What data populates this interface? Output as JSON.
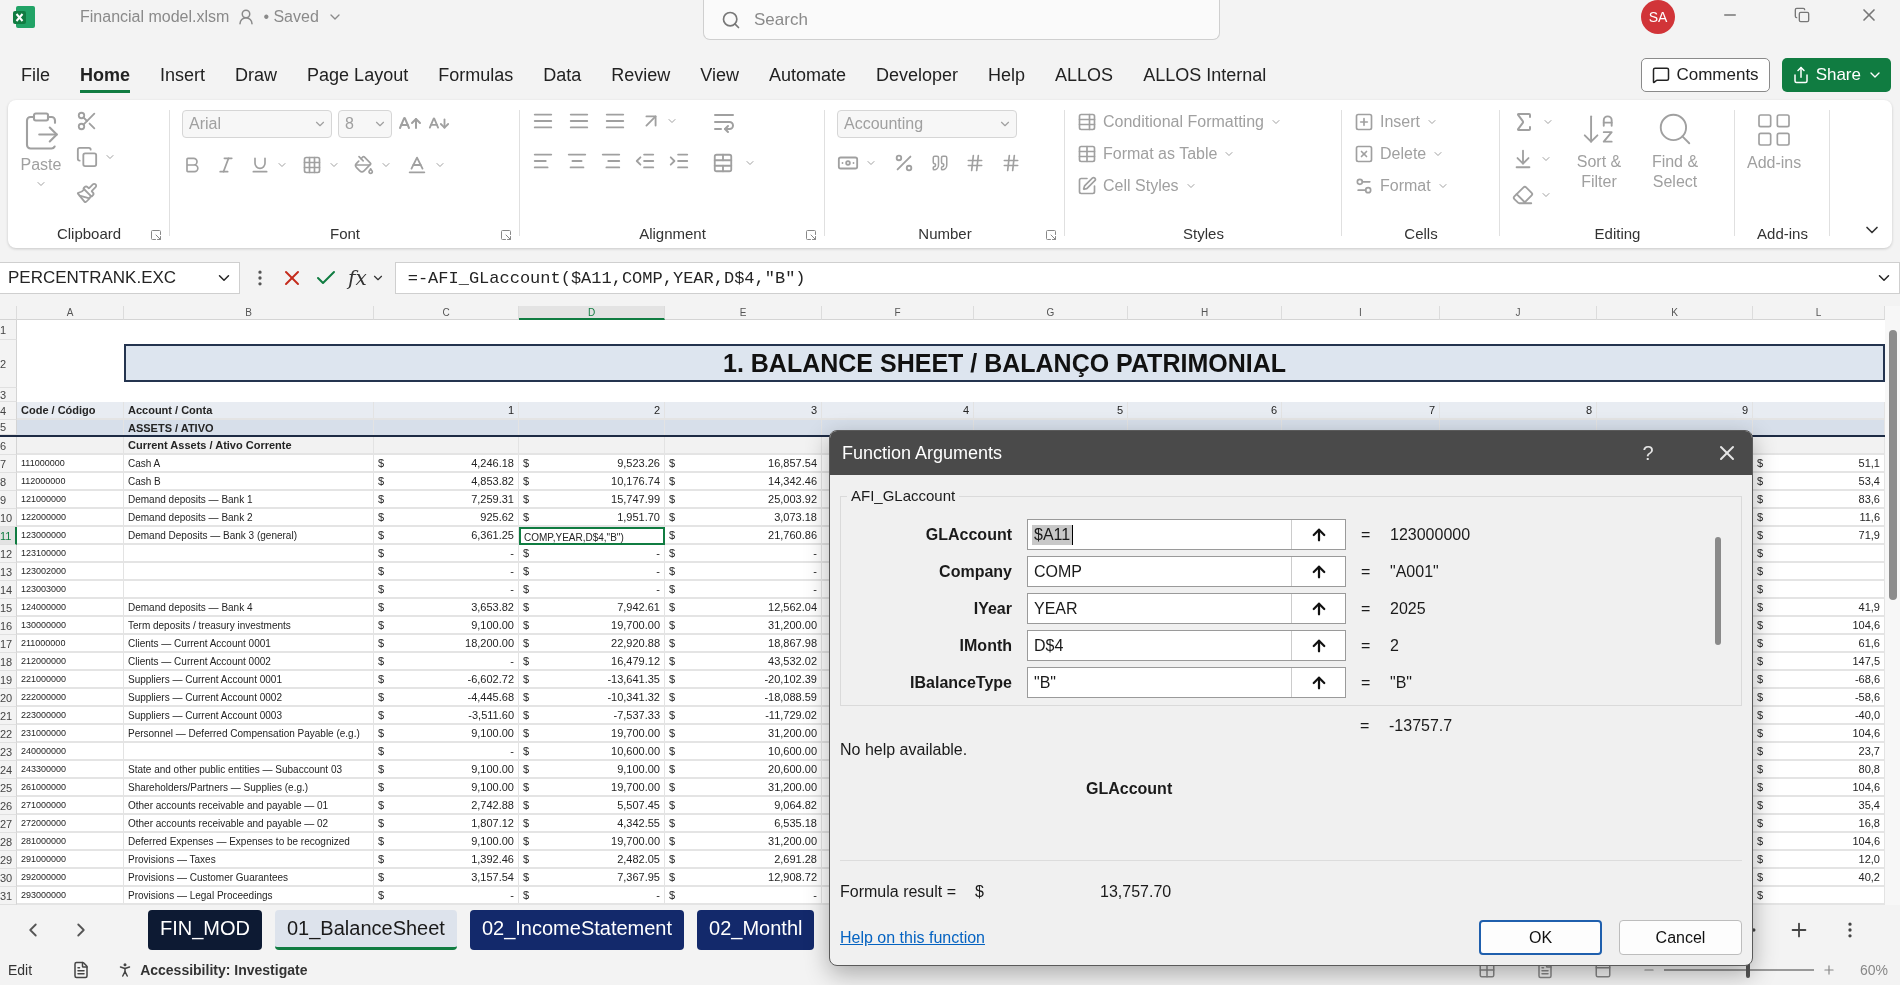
{
  "title_bar": {
    "file_name": "Financial model.xlsm",
    "save_status": "• Saved",
    "search_placeholder": "Search",
    "avatar": "SA"
  },
  "menu": {
    "tabs": [
      {
        "label": "File",
        "selected": false
      },
      {
        "label": "Home",
        "selected": true
      },
      {
        "label": "Insert",
        "selected": false
      },
      {
        "label": "Draw",
        "selected": false
      },
      {
        "label": "Page Layout",
        "selected": false
      },
      {
        "label": "Formulas",
        "selected": false
      },
      {
        "label": "Data",
        "selected": false
      },
      {
        "label": "Review",
        "selected": false
      },
      {
        "label": "View",
        "selected": false
      },
      {
        "label": "Automate",
        "selected": false
      },
      {
        "label": "Developer",
        "selected": false
      },
      {
        "label": "Help",
        "selected": false
      },
      {
        "label": "ALLOS",
        "selected": false
      },
      {
        "label": "ALLOS Internal",
        "selected": false
      }
    ],
    "comments": "Comments",
    "share": "Share"
  },
  "ribbon": {
    "disabled": true,
    "groups": [
      {
        "kind": "clipboard",
        "label": "Clipboard",
        "launcher": true,
        "items": [
          "Paste"
        ]
      },
      {
        "kind": "font",
        "label": "Font",
        "launcher": true,
        "items": [
          "Arial",
          "8"
        ]
      },
      {
        "kind": "alignment",
        "label": "Alignment",
        "launcher": true
      },
      {
        "kind": "number",
        "label": "Number",
        "launcher": true,
        "items": [
          "Accounting"
        ]
      },
      {
        "kind": "styles",
        "label": "Styles",
        "items": [
          "Conditional Formatting",
          "Format as Table",
          "Cell Styles"
        ]
      },
      {
        "kind": "cells",
        "label": "Cells",
        "items": [
          "Insert",
          "Delete",
          "Format"
        ]
      },
      {
        "kind": "editing",
        "label": "Editing",
        "items": [
          "Sort & Filter",
          "Find & Select"
        ]
      },
      {
        "kind": "addins",
        "label": "Add-ins",
        "items": [
          "Add-ins"
        ]
      }
    ]
  },
  "formula_bar": {
    "name_box": "PERCENTRANK.EXC",
    "fx": "fx",
    "formula": "=-AFI_GLaccount($A11,COMP,YEAR,D$4,\"B\")"
  },
  "sheet": {
    "column_letters": [
      {
        "label": "A",
        "selected": false
      },
      {
        "label": "B",
        "selected": false
      },
      {
        "label": "C",
        "selected": false
      },
      {
        "label": "D",
        "selected": true
      },
      {
        "label": "E",
        "selected": false
      },
      {
        "label": "F",
        "selected": false
      },
      {
        "label": "G",
        "selected": false
      },
      {
        "label": "H",
        "selected": false
      },
      {
        "label": "I",
        "selected": false
      },
      {
        "label": "J",
        "selected": false
      },
      {
        "label": "K",
        "selected": false
      },
      {
        "label": "L",
        "selected": false
      }
    ],
    "row_numbers": [
      {
        "label": "1",
        "selected": false
      },
      {
        "label": "2",
        "selected": false
      },
      {
        "label": "3",
        "selected": false
      },
      {
        "label": "4",
        "selected": false
      },
      {
        "label": "5",
        "selected": false
      },
      {
        "label": "6",
        "selected": false
      },
      {
        "label": "7",
        "selected": false
      },
      {
        "label": "8",
        "selected": false
      },
      {
        "label": "9",
        "selected": false
      },
      {
        "label": "10",
        "selected": false
      },
      {
        "label": "11",
        "selected": true
      },
      {
        "label": "12",
        "selected": false
      },
      {
        "label": "13",
        "selected": false
      },
      {
        "label": "14",
        "selected": false
      },
      {
        "label": "15",
        "selected": false
      },
      {
        "label": "16",
        "selected": false
      },
      {
        "label": "17",
        "selected": false
      },
      {
        "label": "18",
        "selected": false
      },
      {
        "label": "19",
        "selected": false
      },
      {
        "label": "20",
        "selected": false
      },
      {
        "label": "21",
        "selected": false
      },
      {
        "label": "22",
        "selected": false
      },
      {
        "label": "23",
        "selected": false
      },
      {
        "label": "24",
        "selected": false
      },
      {
        "label": "25",
        "selected": false
      },
      {
        "label": "26",
        "selected": false
      },
      {
        "label": "27",
        "selected": false
      },
      {
        "label": "28",
        "selected": false
      },
      {
        "label": "29",
        "selected": false
      },
      {
        "label": "30",
        "selected": false
      },
      {
        "label": "31",
        "selected": false
      }
    ],
    "title": "1. BALANCE SHEET / BALANÇO PATRIMONIAL",
    "header": {
      "code": "Code / Código",
      "account": "Account / Conta",
      "periods": [
        "1",
        "2",
        "3",
        "4",
        "5",
        "6",
        "7",
        "8",
        "9"
      ]
    },
    "section": "ASSETS / ATIVO",
    "subsection": "Current Assets / Ativo Corrente",
    "rows": [
      {
        "code": "111000000",
        "account": "Cash A",
        "cells": [
          {
            "sym": "$",
            "val": "4,246.18",
            "selected": false
          },
          {
            "sym": "$",
            "val": "9,523.26",
            "selected": false
          },
          {
            "sym": "$",
            "val": "16,857.54",
            "selected": false
          }
        ],
        "col_l": {
          "sym": "$",
          "val": "51,1"
        }
      },
      {
        "code": "112000000",
        "account": "Cash B",
        "cells": [
          {
            "sym": "$",
            "val": "4,853.82",
            "selected": false
          },
          {
            "sym": "$",
            "val": "10,176.74",
            "selected": false
          },
          {
            "sym": "$",
            "val": "14,342.46",
            "selected": false
          }
        ],
        "col_l": {
          "sym": "$",
          "val": "53,4"
        }
      },
      {
        "code": "121000000",
        "account": "Demand deposits — Bank 1",
        "cells": [
          {
            "sym": "$",
            "val": "7,259.31",
            "selected": false
          },
          {
            "sym": "$",
            "val": "15,747.99",
            "selected": false
          },
          {
            "sym": "$",
            "val": "25,003.92",
            "selected": false
          }
        ],
        "col_l": {
          "sym": "$",
          "val": "83,6"
        }
      },
      {
        "code": "122000000",
        "account": "Demand deposits — Bank 2",
        "cells": [
          {
            "sym": "$",
            "val": "925.62",
            "selected": false
          },
          {
            "sym": "$",
            "val": "1,951.70",
            "selected": false
          },
          {
            "sym": "$",
            "val": "3,073.18",
            "selected": false
          }
        ],
        "col_l": {
          "sym": "$",
          "val": "11,6"
        }
      },
      {
        "code": "123000000",
        "account": "Demand Deposits — Bank 3 (general)",
        "cells": [
          {
            "sym": "$",
            "val": "6,361.25",
            "selected": false
          },
          {
            "val": "COMP,YEAR,D$4,\"B\")",
            "selected": true
          },
          {
            "sym": "$",
            "val": "21,760.86",
            "selected": false
          }
        ],
        "col_l": {
          "sym": "$",
          "val": "71,9"
        }
      },
      {
        "code": "123100000",
        "cells": [
          {
            "sym": "$",
            "val": "-",
            "selected": false
          },
          {
            "sym": "$",
            "val": "-",
            "selected": false
          },
          {
            "sym": "$",
            "val": "-",
            "selected": false
          }
        ],
        "col_l": {
          "sym": "$"
        }
      },
      {
        "code": "123002000",
        "cells": [
          {
            "sym": "$",
            "val": "-",
            "selected": false
          },
          {
            "sym": "$",
            "val": "-",
            "selected": false
          },
          {
            "sym": "$",
            "val": "-",
            "selected": false
          }
        ],
        "col_l": {
          "sym": "$"
        }
      },
      {
        "code": "123003000",
        "cells": [
          {
            "sym": "$",
            "val": "-",
            "selected": false
          },
          {
            "sym": "$",
            "val": "-",
            "selected": false
          },
          {
            "sym": "$",
            "val": "-",
            "selected": false
          }
        ],
        "col_l": {
          "sym": "$"
        }
      },
      {
        "code": "124000000",
        "account": "Demand deposits — Bank 4",
        "cells": [
          {
            "sym": "$",
            "val": "3,653.82",
            "selected": false
          },
          {
            "sym": "$",
            "val": "7,942.61",
            "selected": false
          },
          {
            "sym": "$",
            "val": "12,562.04",
            "selected": false
          }
        ],
        "col_l": {
          "sym": "$",
          "val": "41,9"
        }
      },
      {
        "code": "130000000",
        "account": "Term deposits / treasury investments",
        "cells": [
          {
            "sym": "$",
            "val": "9,100.00",
            "selected": false
          },
          {
            "sym": "$",
            "val": "19,700.00",
            "selected": false
          },
          {
            "sym": "$",
            "val": "31,200.00",
            "selected": false
          }
        ],
        "col_l": {
          "sym": "$",
          "val": "104,6"
        }
      },
      {
        "code": "211000000",
        "account": "Clients — Current Account 0001",
        "cells": [
          {
            "sym": "$",
            "val": "18,200.00",
            "selected": false
          },
          {
            "sym": "$",
            "val": "22,920.88",
            "selected": false
          },
          {
            "sym": "$",
            "val": "18,867.98",
            "selected": false
          }
        ],
        "col_l": {
          "sym": "$",
          "val": "61,6"
        }
      },
      {
        "code": "212000000",
        "account": "Clients — Current Account 0002",
        "cells": [
          {
            "sym": "$",
            "val": "-",
            "selected": false
          },
          {
            "sym": "$",
            "val": "16,479.12",
            "selected": false
          },
          {
            "sym": "$",
            "val": "43,532.02",
            "selected": false
          }
        ],
        "col_l": {
          "sym": "$",
          "val": "147,5"
        }
      },
      {
        "code": "221000000",
        "account": "Suppliers — Current Account 0001",
        "cells": [
          {
            "sym": "$",
            "val": "-6,602.72",
            "selected": false
          },
          {
            "sym": "$",
            "val": "-13,641.35",
            "selected": false
          },
          {
            "sym": "$",
            "val": "-20,102.39",
            "selected": false
          }
        ],
        "col_l": {
          "sym": "$",
          "val": "-68,6"
        }
      },
      {
        "code": "222000000",
        "account": "Suppliers — Current Account 0002",
        "cells": [
          {
            "sym": "$",
            "val": "-4,445.68",
            "selected": false
          },
          {
            "sym": "$",
            "val": "-10,341.32",
            "selected": false
          },
          {
            "sym": "$",
            "val": "-18,088.59",
            "selected": false
          }
        ],
        "col_l": {
          "sym": "$",
          "val": "-58,6"
        }
      },
      {
        "code": "223000000",
        "account": "Suppliers — Current Account 0003",
        "cells": [
          {
            "sym": "$",
            "val": "-3,511.60",
            "selected": false
          },
          {
            "sym": "$",
            "val": "-7,537.33",
            "selected": false
          },
          {
            "sym": "$",
            "val": "-11,729.02",
            "selected": false
          }
        ],
        "col_l": {
          "sym": "$",
          "val": "-40,0"
        }
      },
      {
        "code": "231000000",
        "account": "Personnel — Deferred Compensation Payable (e.g.)",
        "cells": [
          {
            "sym": "$",
            "val": "9,100.00",
            "selected": false
          },
          {
            "sym": "$",
            "val": "19,700.00",
            "selected": false
          },
          {
            "sym": "$",
            "val": "31,200.00",
            "selected": false
          }
        ],
        "col_l": {
          "sym": "$",
          "val": "104,6"
        }
      },
      {
        "code": "240000000",
        "cells": [
          {
            "sym": "$",
            "val": "-",
            "selected": false
          },
          {
            "sym": "$",
            "val": "10,600.00",
            "selected": false
          },
          {
            "sym": "$",
            "val": "10,600.00",
            "selected": false
          }
        ],
        "col_l": {
          "sym": "$",
          "val": "23,7"
        }
      },
      {
        "code": "243300000",
        "account": "State and other public entities — Subaccount 03",
        "cells": [
          {
            "sym": "$",
            "val": "9,100.00",
            "selected": false
          },
          {
            "sym": "$",
            "val": "9,100.00",
            "selected": false
          },
          {
            "sym": "$",
            "val": "20,600.00",
            "selected": false
          }
        ],
        "col_l": {
          "sym": "$",
          "val": "80,8"
        }
      },
      {
        "code": "261000000",
        "account": "Shareholders/Partners — Supplies (e.g.)",
        "cells": [
          {
            "sym": "$",
            "val": "9,100.00",
            "selected": false
          },
          {
            "sym": "$",
            "val": "19,700.00",
            "selected": false
          },
          {
            "sym": "$",
            "val": "31,200.00",
            "selected": false
          }
        ],
        "col_l": {
          "sym": "$",
          "val": "104,6"
        }
      },
      {
        "code": "271000000",
        "account": "Other accounts receivable and payable — 01",
        "cells": [
          {
            "sym": "$",
            "val": "2,742.88",
            "selected": false
          },
          {
            "sym": "$",
            "val": "5,507.45",
            "selected": false
          },
          {
            "sym": "$",
            "val": "9,064.82",
            "selected": false
          }
        ],
        "col_l": {
          "sym": "$",
          "val": "35,4"
        }
      },
      {
        "code": "272000000",
        "account": "Other accounts receivable and payable — 02",
        "cells": [
          {
            "sym": "$",
            "val": "1,807.12",
            "selected": false
          },
          {
            "sym": "$",
            "val": "4,342.55",
            "selected": false
          },
          {
            "sym": "$",
            "val": "6,535.18",
            "selected": false
          }
        ],
        "col_l": {
          "sym": "$",
          "val": "16,8"
        }
      },
      {
        "code": "281000000",
        "account": "Deferred Expenses — Expenses to be recognized",
        "cells": [
          {
            "sym": "$",
            "val": "9,100.00",
            "selected": false
          },
          {
            "sym": "$",
            "val": "19,700.00",
            "selected": false
          },
          {
            "sym": "$",
            "val": "31,200.00",
            "selected": false
          }
        ],
        "col_l": {
          "sym": "$",
          "val": "104,6"
        }
      },
      {
        "code": "291000000",
        "account": "Provisions — Taxes",
        "cells": [
          {
            "sym": "$",
            "val": "1,392.46",
            "selected": false
          },
          {
            "sym": "$",
            "val": "2,482.05",
            "selected": false
          },
          {
            "sym": "$",
            "val": "2,691.28",
            "selected": false
          }
        ],
        "col_l": {
          "sym": "$",
          "val": "12,0"
        }
      },
      {
        "code": "292000000",
        "account": "Provisions — Customer Guarantees",
        "cells": [
          {
            "sym": "$",
            "val": "3,157.54",
            "selected": false
          },
          {
            "sym": "$",
            "val": "7,367.95",
            "selected": false
          },
          {
            "sym": "$",
            "val": "12,908.72",
            "selected": false
          }
        ],
        "col_l": {
          "sym": "$",
          "val": "40,2"
        }
      },
      {
        "code": "293000000",
        "account": "Provisions — Legal Proceedings",
        "cells": [
          {
            "sym": "$",
            "val": "-",
            "selected": false
          },
          {
            "sym": "$",
            "val": "-",
            "selected": false
          },
          {
            "sym": "$",
            "val": "-",
            "selected": false
          }
        ],
        "col_l": {
          "sym": "$"
        }
      }
    ]
  },
  "sheet_tabs": [
    {
      "label": "FIN_MOD",
      "selected": false,
      "color": "#0d1a33"
    },
    {
      "label": "01_BalanceSheet",
      "selected": true,
      "color": "#dde3ec"
    },
    {
      "label": "02_IncomeStatement",
      "selected": false,
      "color": "#13296b"
    },
    {
      "label": "02_Monthl",
      "selected": false,
      "color": "#13296b"
    }
  ],
  "status_bar": {
    "mode": "Edit",
    "accessibility": "Accessibility: Investigate",
    "zoom": {
      "label": "60%",
      "level": 0.56
    }
  },
  "dialog": {
    "title": "Function Arguments",
    "help": "?",
    "function_name": "AFI_GLaccount",
    "args": [
      {
        "name": "GLAccount",
        "value": "$A11",
        "sign": "=",
        "result": "123000000",
        "selected": true
      },
      {
        "name": "Company",
        "value": "COMP",
        "sign": "=",
        "result": "\"A001\"",
        "selected": false
      },
      {
        "name": "IYear",
        "value": "YEAR",
        "sign": "=",
        "result": "2025",
        "selected": false
      },
      {
        "name": "IMonth",
        "value": "D$4",
        "sign": "=",
        "result": "2",
        "selected": false
      },
      {
        "name": "IBalanceType",
        "value": "\"B\"",
        "sign": "=",
        "result": "\"B\"",
        "selected": false
      }
    ],
    "result_sign": "=",
    "result": "-13757.7",
    "help_text": "No help available.",
    "arg_name": "GLAccount",
    "formula_result_label": "Formula result =",
    "formula_result_currency": "$",
    "formula_result": "13,757.70",
    "help_link": "Help on this function",
    "buttons": [
      {
        "label": "OK",
        "default": true
      },
      {
        "label": "Cancel",
        "default": false
      }
    ]
  }
}
